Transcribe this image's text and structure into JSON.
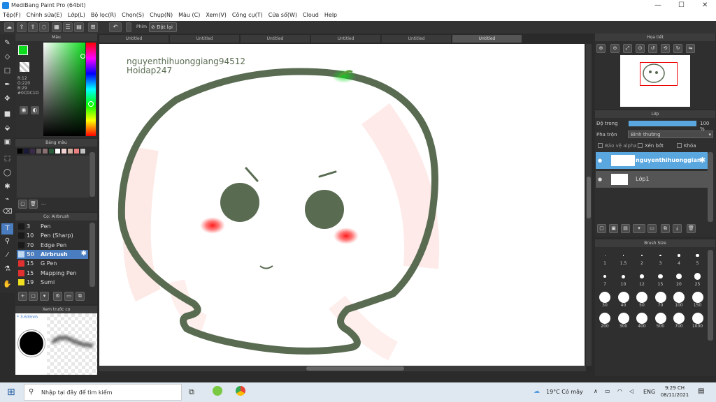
{
  "window": {
    "title": "MediBang Paint Pro (64bit)",
    "minimize": "—",
    "maximize": "☐",
    "close": "✕"
  },
  "menu": [
    "Tệp(F)",
    "Chỉnh sửa(E)",
    "Lớp(L)",
    "Bộ lọc(R)",
    "Chọn(S)",
    "Chụp(N)",
    "Màu (C)",
    "Xem(V)",
    "Công cụ(T)",
    "Cửa sổ(W)",
    "Cloud",
    "Help"
  ],
  "toolbar": {
    "key_label": "Phím",
    "reset_label": "Đặt lại"
  },
  "tabs": [
    "Untitled",
    "Untitled",
    "Untitled",
    "Untitled",
    "Untitled",
    "Untitled"
  ],
  "color_panel": {
    "title": "Màu",
    "r": "R:12",
    "g": "G:220",
    "b": "B:29",
    "hex": "#0CDC1D",
    "foreground": "#0cdc1d"
  },
  "palette_panel": {
    "title": "Bảng màu",
    "swatches": [
      "#000000",
      "#1a1a3a",
      "#3a2a4a",
      "#6a6060",
      "#8a7070",
      "#2a5a3a",
      "#ffffff",
      "#f0d0d0",
      "#d0b0a0",
      "#e88080",
      "#c0c0c0"
    ],
    "page": "---"
  },
  "brush_panel": {
    "title": "Cọ: Airbrush",
    "items": [
      {
        "size": "3",
        "name": "Pen",
        "color": "#1a1a1a"
      },
      {
        "size": "10",
        "name": "Pen (Sharp)",
        "color": "#1a1a1a"
      },
      {
        "size": "70",
        "name": "Edge Pen",
        "color": "#1a1a1a"
      },
      {
        "size": "50",
        "name": "Airbrush",
        "color": "#c0d8f0"
      },
      {
        "size": "15",
        "name": "G Pen",
        "color": "#e03030"
      },
      {
        "size": "15",
        "name": "Mapping Pen",
        "color": "#e03030"
      },
      {
        "size": "19",
        "name": "Sumi",
        "color": "#f0e020"
      }
    ]
  },
  "preview_panel": {
    "title": "Xem trước cọ",
    "size": "* 3.63mm"
  },
  "canvas": {
    "watermark_line1": "nguyenthihuonggiang94512",
    "watermark_line2": "Hoidap247"
  },
  "navigator_panel": {
    "title": "Họa tiết"
  },
  "layer_panel": {
    "title": "Lớp",
    "opacity_label": "Độ trong",
    "opacity_value": "100 %",
    "opacity_percent": 100,
    "blend_label": "Pha trộn",
    "blend_value": "Bình thường",
    "alpha_label": "Bảo vệ alpha",
    "clip_label": "Xén bớt",
    "lock_label": "Khóa",
    "layers": [
      {
        "name": "nguyenthihuonggiang"
      },
      {
        "name": "Lớp1"
      }
    ]
  },
  "brush_size_panel": {
    "title": "Brush Size",
    "sizes": [
      "1",
      "1.5",
      "2",
      "3",
      "4",
      "5",
      "7",
      "10",
      "12",
      "15",
      "20",
      "25",
      "30",
      "40",
      "50",
      "70",
      "100",
      "150",
      "200",
      "300",
      "400",
      "500",
      "700",
      "1000"
    ]
  },
  "taskbar": {
    "search_placeholder": "Nhập tại đây để tìm kiếm",
    "weather": "19°C Có mây",
    "lang": "ENG",
    "time": "9:29 CH",
    "date": "08/11/2021"
  }
}
